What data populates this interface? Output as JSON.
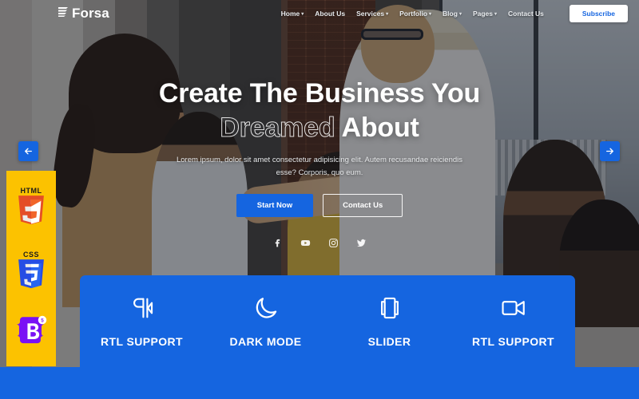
{
  "theme": {
    "primary_blue": "#1565e0",
    "accent_yellow": "#fcc200",
    "white": "#ffffff",
    "html5_orange": "#e44d26",
    "css3_blue": "#2965f1",
    "bootstrap_purple": "#7a11f5"
  },
  "header": {
    "logo_text": "Forsa",
    "logo_icon": "stacked-lines-icon",
    "nav": [
      {
        "label": "Home",
        "has_dropdown": true
      },
      {
        "label": "About Us",
        "has_dropdown": false
      },
      {
        "label": "Services",
        "has_dropdown": true
      },
      {
        "label": "Portfolio",
        "has_dropdown": true
      },
      {
        "label": "Blog",
        "has_dropdown": true
      },
      {
        "label": "Pages",
        "has_dropdown": true
      },
      {
        "label": "Contact Us",
        "has_dropdown": false
      }
    ],
    "caret": "▾",
    "subscribe_label": "Subscribe"
  },
  "hero": {
    "headline_line1": "Create The Business You",
    "headline_outlined_word": "Dreamed",
    "headline_solid_word": "About",
    "subtext": "Lorem ipsum, dolor sit amet consectetur adipisicing elit. Autem recusandae reiciendis esse? Corporis, quo eum.",
    "primary_button": "Start Now",
    "secondary_button": "Contact Us",
    "socials": [
      {
        "name": "facebook-icon"
      },
      {
        "name": "youtube-icon"
      },
      {
        "name": "instagram-icon"
      },
      {
        "name": "twitter-icon"
      }
    ],
    "prev_arrow": "←",
    "next_arrow": "→"
  },
  "tech_rail": [
    {
      "label": "HTML",
      "version": "5",
      "icon": "html5-shield-icon"
    },
    {
      "label": "CSS",
      "version": "3",
      "icon": "css3-shield-icon"
    },
    {
      "label": "B",
      "version": "5",
      "icon": "bootstrap-icon"
    }
  ],
  "features": [
    {
      "label": "RTL SUPPORT",
      "icon": "pilcrow-rtl-icon"
    },
    {
      "label": "DARK MODE",
      "icon": "moon-icon"
    },
    {
      "label": "SLIDER",
      "icon": "carousel-slider-icon"
    },
    {
      "label": "RTL SUPPORT",
      "icon": "video-camera-icon"
    }
  ]
}
